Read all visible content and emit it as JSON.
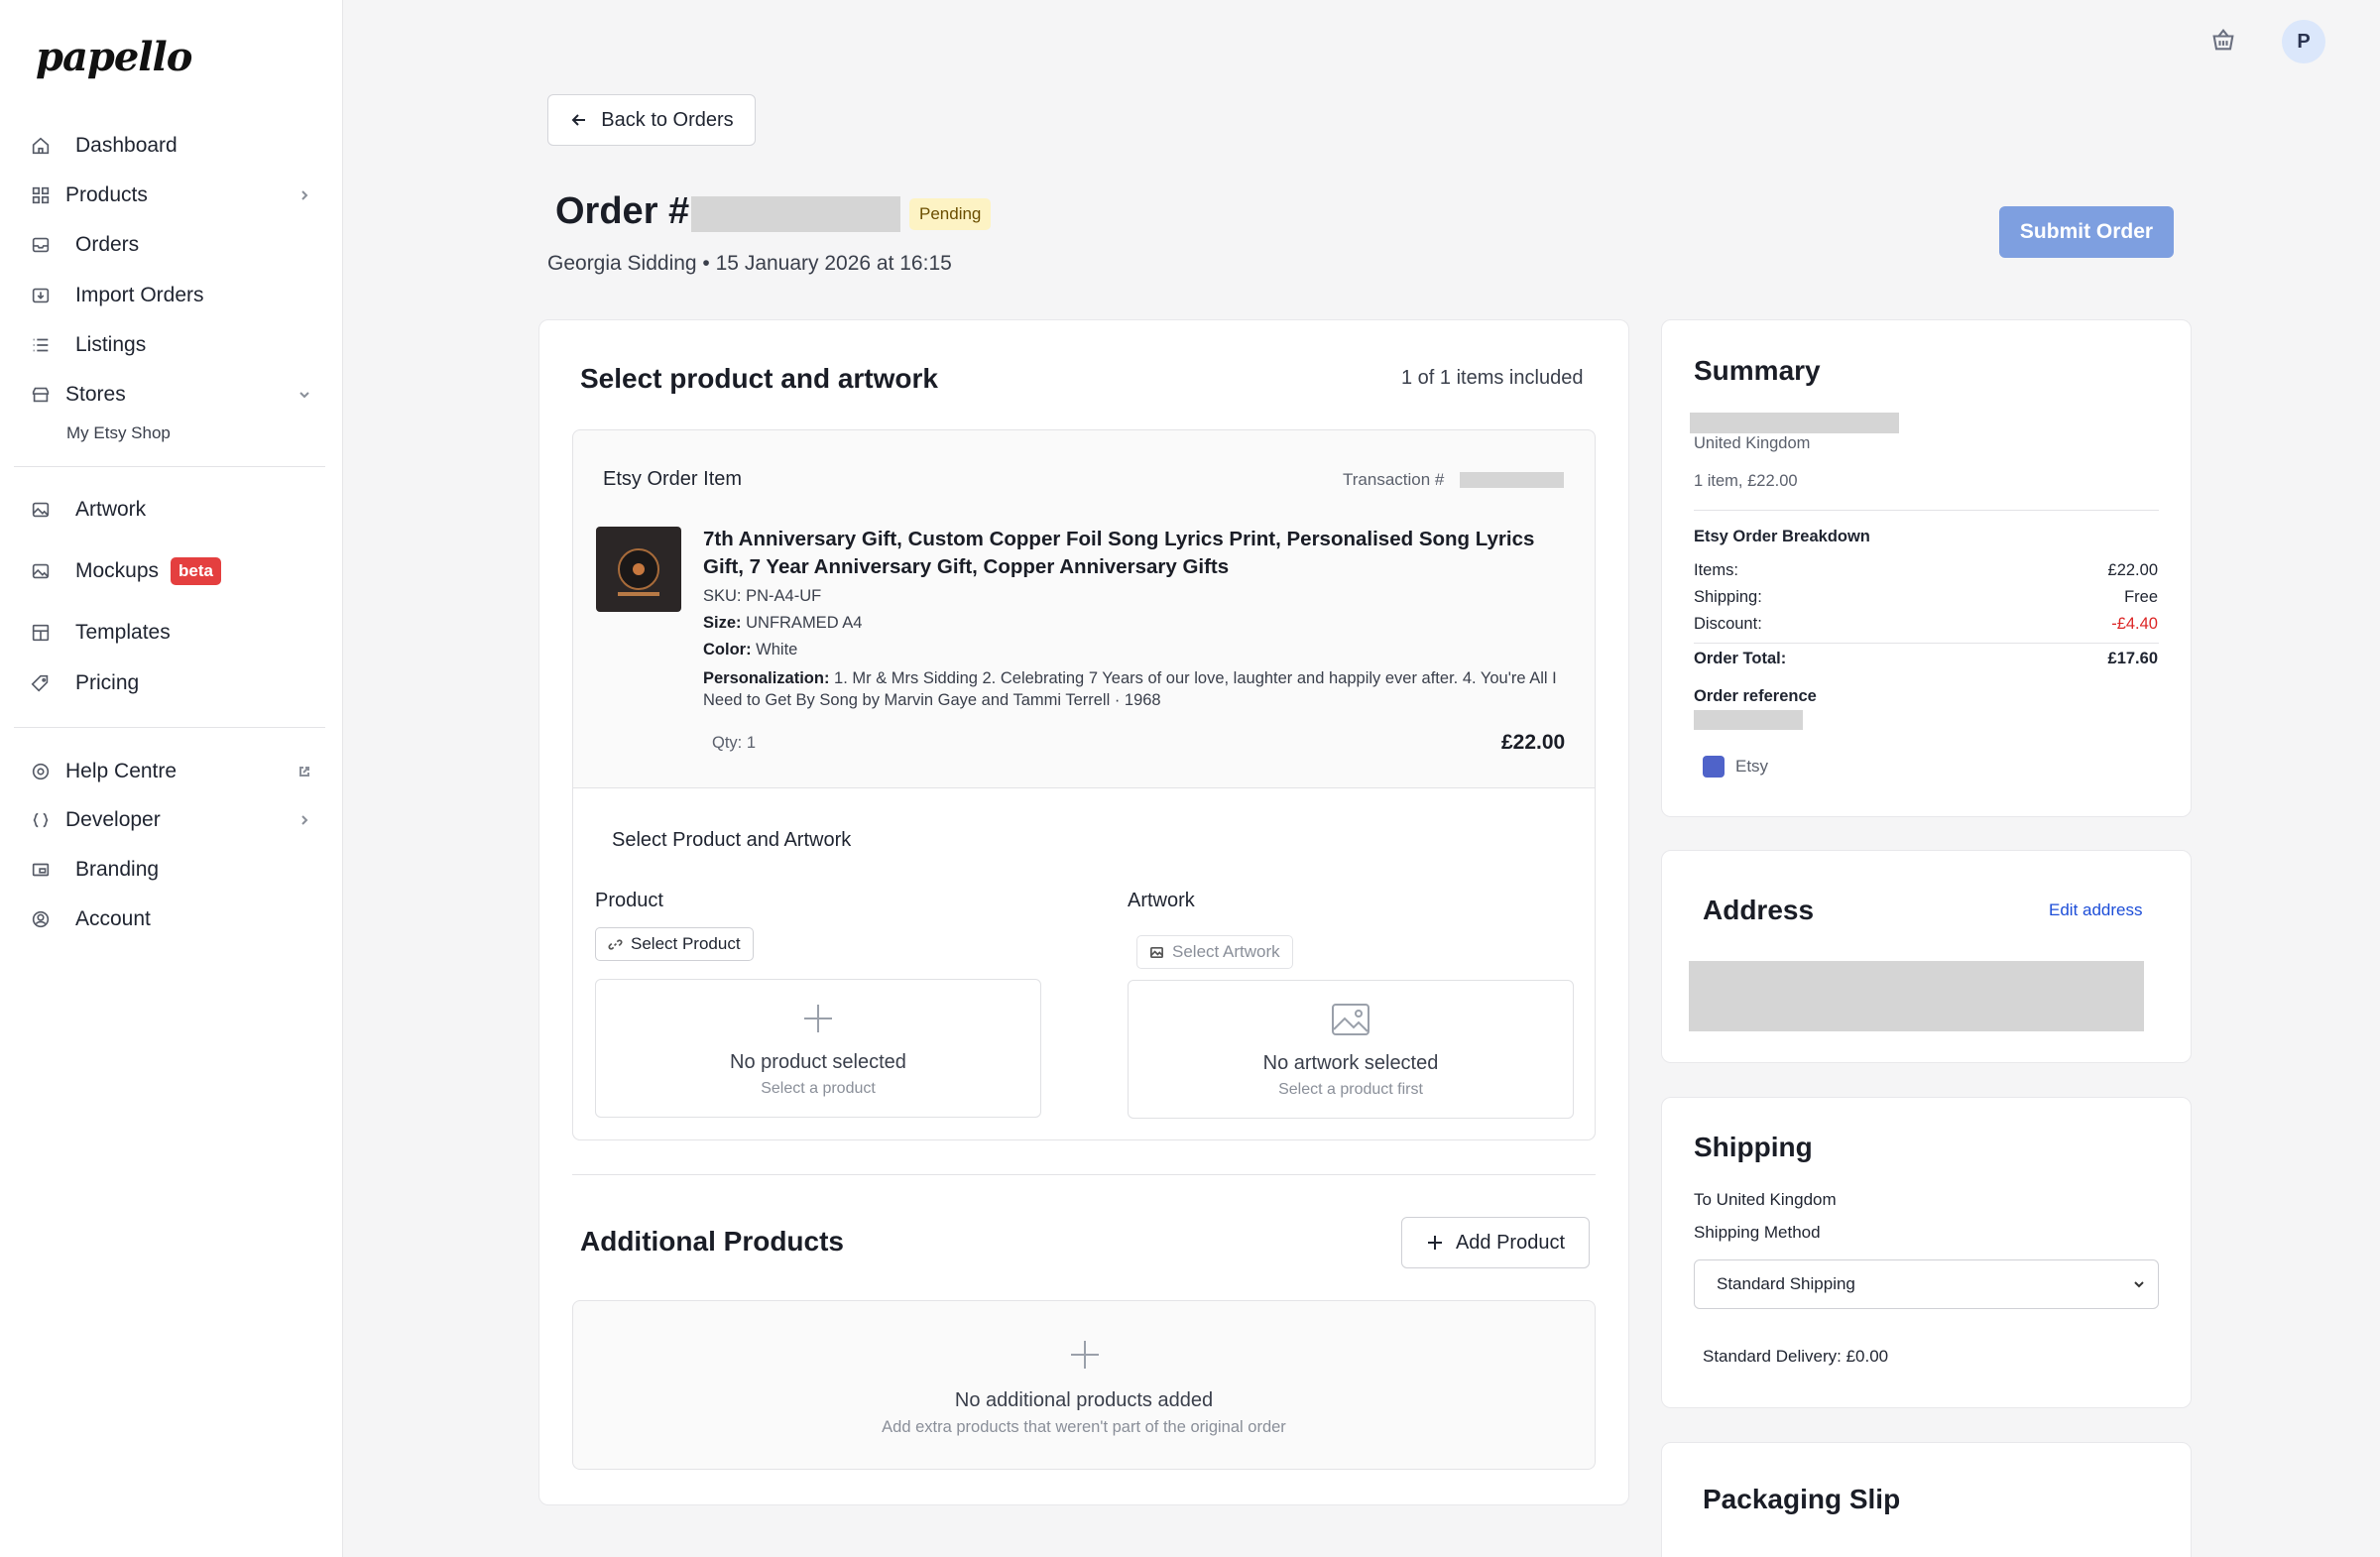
{
  "brand": {
    "logo_text": "papello"
  },
  "sidebar": {
    "items": [
      {
        "label": "Dashboard",
        "icon": "home-icon"
      },
      {
        "label": "Products",
        "icon": "grid-icon"
      },
      {
        "label": "Orders",
        "icon": "inbox-icon"
      },
      {
        "label": "Import Orders",
        "icon": "import-icon"
      },
      {
        "label": "Listings",
        "icon": "list-icon"
      },
      {
        "label": "Stores",
        "icon": "store-icon"
      },
      {
        "label": "Artwork",
        "icon": "image-icon"
      },
      {
        "label": "Mockups",
        "icon": "images-icon",
        "badge": "beta"
      },
      {
        "label": "Templates",
        "icon": "template-icon"
      },
      {
        "label": "Pricing",
        "icon": "tag-icon"
      },
      {
        "label": "Help Centre",
        "icon": "help-icon"
      },
      {
        "label": "Developer",
        "icon": "code-icon"
      },
      {
        "label": "Branding",
        "icon": "branding-icon"
      },
      {
        "label": "Account",
        "icon": "account-icon"
      }
    ],
    "stores_sub": "My Etsy Shop"
  },
  "header": {
    "back_label": "Back to Orders",
    "order_title": "Order #",
    "status": "Pending",
    "subtitle": "Georgia Sidding • 15 January 2026 at 16:15",
    "submit_label": "Submit Order",
    "user_initial": "P"
  },
  "main": {
    "section_title": "Select product and artwork",
    "items_included": "1 of 1 items included",
    "etsy_item": {
      "heading": "Etsy Order Item",
      "transaction_prefix": "Transaction #",
      "title": "7th Anniversary Gift, Custom Copper Foil Song Lyrics Print, Personalised Song Lyrics Gift, 7 Year Anniversary Gift, Copper Anniversary Gifts",
      "sku_label": "SKU:",
      "sku": "PN-A4-UF",
      "size_label": "Size:",
      "size": "UNFRAMED A4",
      "color_label": "Color:",
      "color": "White",
      "personalization_label": "Personalization:",
      "personalization": "1. Mr & Mrs Sidding 2. Celebrating 7 Years of our love, laughter and happily ever after. 4. You're All I Need to Get By Song by Marvin Gaye and Tammi Terrell · 1968",
      "qty": "Qty: 1",
      "price": "£22.00"
    },
    "select_block": {
      "heading": "Select Product and Artwork",
      "product_label": "Product",
      "select_product_btn": "Select Product",
      "no_product": "No product selected",
      "no_product_hint": "Select a product",
      "artwork_label": "Artwork",
      "select_artwork_btn": "Select Artwork",
      "no_artwork": "No artwork selected",
      "no_artwork_hint": "Select a product first"
    },
    "additional": {
      "title": "Additional Products",
      "add_btn": "Add Product",
      "empty_title": "No additional products added",
      "empty_hint": "Add extra products that weren't part of the original order"
    }
  },
  "summary": {
    "title": "Summary",
    "country": "United Kingdom",
    "items_line": "1 item, £22.00",
    "breakdown_title": "Etsy Order Breakdown",
    "rows": [
      {
        "label": "Items:",
        "value": "£22.00"
      },
      {
        "label": "Shipping:",
        "value": "Free"
      },
      {
        "label": "Discount:",
        "value": "-£4.40"
      }
    ],
    "total_label": "Order Total:",
    "total_value": "£17.60",
    "reference_label": "Order reference",
    "source": "Etsy",
    "discount_color": "#dc2626"
  },
  "address": {
    "title": "Address",
    "edit_label": "Edit address"
  },
  "shipping": {
    "title": "Shipping",
    "to": "To United Kingdom",
    "method_label": "Shipping Method",
    "method_value": "Standard Shipping",
    "delivery": "Standard Delivery: £0.00"
  },
  "packaging": {
    "title": "Packaging Slip"
  },
  "colors": {
    "accent": "#7e9fe0",
    "pending_bg": "#fdf3c4",
    "beta": "#e43f3f",
    "link": "#1d4ed8"
  }
}
